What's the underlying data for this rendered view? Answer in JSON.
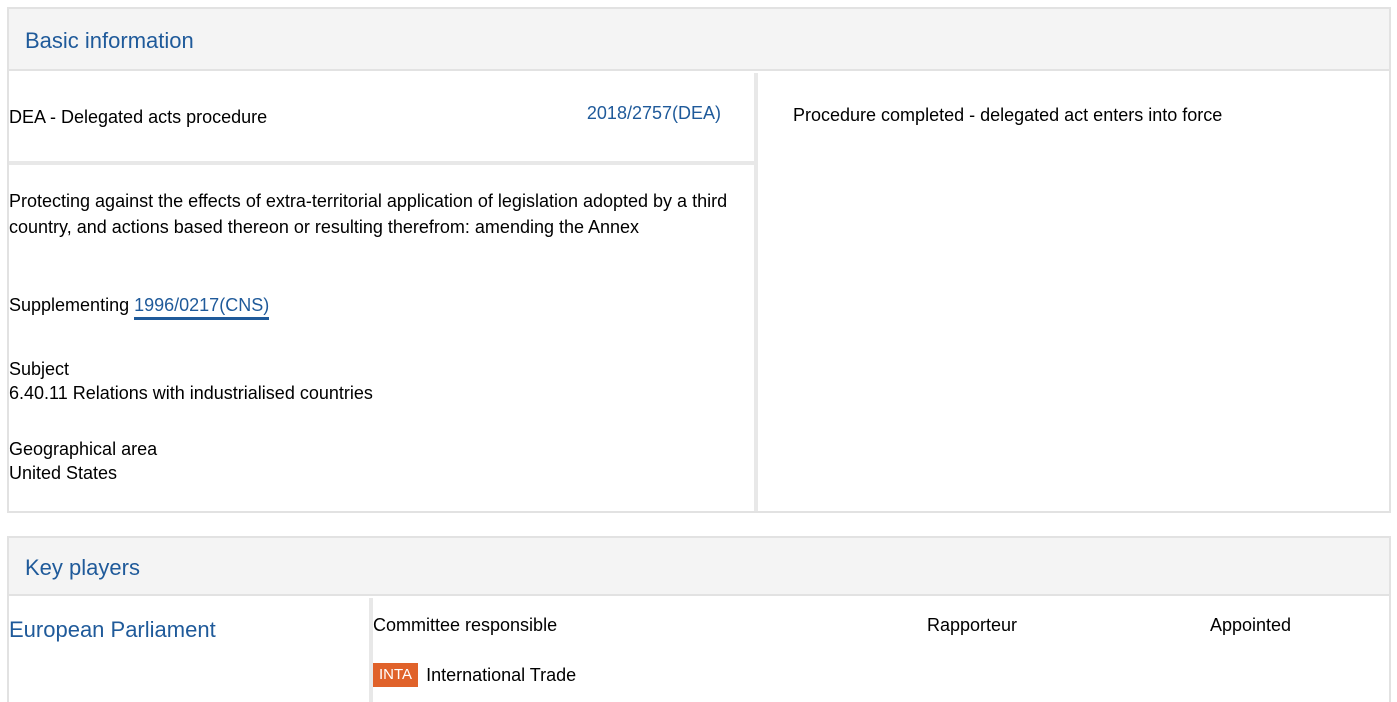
{
  "basic_info": {
    "title": "Basic information",
    "procedure_type": "DEA - Delegated acts procedure",
    "reference": "2018/2757(DEA)",
    "status": "Procedure completed - delegated act enters into force",
    "description": "Protecting against the effects of extra-territorial application of legislation adopted by a third country, and actions based thereon or resulting therefrom: amending the Annex",
    "supplementing_label": "Supplementing",
    "supplementing_ref": "1996/0217(CNS)",
    "subject_label": "Subject",
    "subject_value": "6.40.11 Relations with industrialised countries",
    "geo_label": "Geographical area",
    "geo_value": "United States"
  },
  "key_players": {
    "title": "Key players",
    "institution": "European Parliament",
    "columns": {
      "committee": "Committee responsible",
      "rapporteur": "Rapporteur",
      "appointed": "Appointed"
    },
    "committee": {
      "code": "INTA",
      "name": "International Trade",
      "badge_color": "#e0622a"
    }
  }
}
